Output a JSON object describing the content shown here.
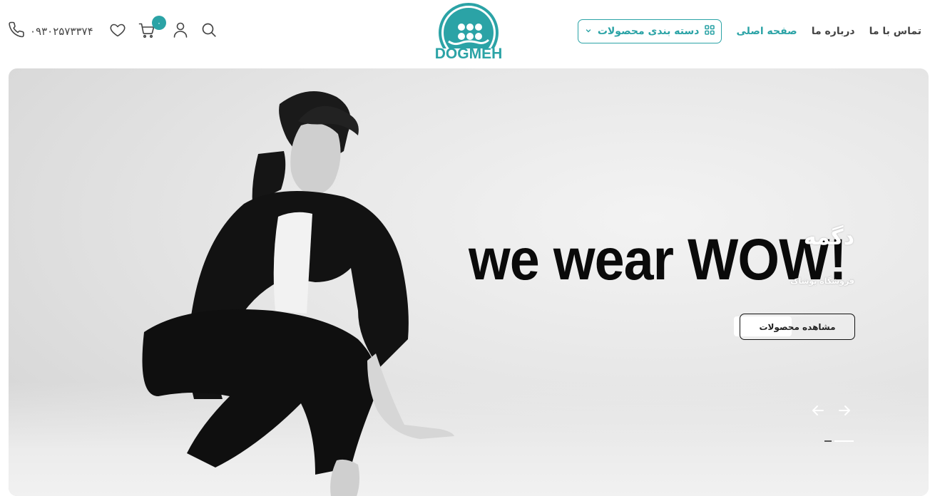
{
  "header": {
    "phone": "۰۹۳۰۲۵۷۳۳۷۴",
    "cart_count": "۰",
    "logo_text": "DOGMEH",
    "nav": {
      "categories_label": "دسته بندی محصولات",
      "home_label": "صفحه اصلی",
      "about_label": "درباره ما",
      "contact_label": "تماس با ما"
    }
  },
  "hero": {
    "headline": "we wear WOW!",
    "brand_name": "دگمه",
    "subtitle": "فروشگاه پوشاک",
    "cta_label": "مشاهده محصولات"
  },
  "colors": {
    "accent": "#2ba3a6",
    "text": "#444444"
  },
  "icons": [
    "phone-icon",
    "heart-icon",
    "cart-icon",
    "user-icon",
    "search-icon",
    "grid-icon",
    "chevron-down-icon",
    "arrow-left-icon",
    "arrow-right-icon"
  ]
}
